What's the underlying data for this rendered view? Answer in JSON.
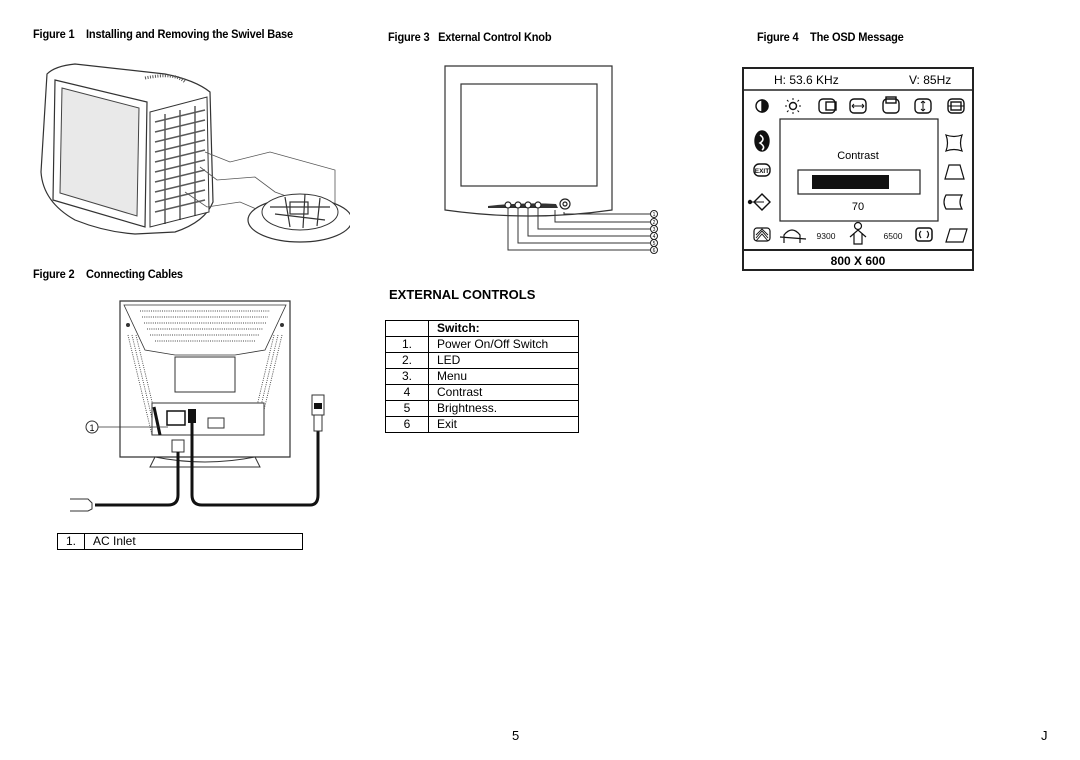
{
  "figures": {
    "fig1": {
      "label": "Figure 1",
      "title": "Installing and Removing the Swivel Base"
    },
    "fig2": {
      "label": "Figure 2",
      "title": "Connecting Cables",
      "callout": "1"
    },
    "fig3": {
      "label": "Figure 3",
      "title": "External Control Knob",
      "callouts": [
        "1",
        "2",
        "3",
        "4",
        "5",
        "6"
      ]
    },
    "fig4": {
      "label": "Figure 4",
      "title": "The OSD Message"
    }
  },
  "ac_table": {
    "rows": [
      {
        "num": "1.",
        "label": "AC Inlet"
      }
    ]
  },
  "external_controls": {
    "heading": "EXTERNAL CONTROLS",
    "header": "Switch:",
    "rows": [
      {
        "num": "1.",
        "label": "Power On/Off Switch"
      },
      {
        "num": "2.",
        "label": "LED"
      },
      {
        "num": "3.",
        "label": "Menu"
      },
      {
        "num": "4",
        "label": "Contrast"
      },
      {
        "num": "5",
        "label": "Brightness."
      },
      {
        "num": "6",
        "label": "Exit"
      }
    ]
  },
  "osd": {
    "h_freq": "H: 53.6 KHz",
    "v_freq": "V: 85Hz",
    "panel_title": "Contrast",
    "value": "70",
    "value_fraction": 0.7,
    "color_temp_1": "9300",
    "color_temp_2": "6500",
    "resolution": "800 X 600",
    "top_icons": [
      "contrast-icon",
      "brightness-icon",
      "h-position-icon",
      "h-size-icon",
      "v-position-icon",
      "v-size-icon",
      "zoom-icon"
    ],
    "left_icons": [
      "language-icon",
      "exit-icon",
      "recall-icon"
    ],
    "right_icons": [
      "pincushion-icon",
      "trapezoid-icon",
      "pin-balance-icon"
    ],
    "bottom_icons": [
      "moire-icon",
      "degauss-icon",
      "user-color-icon",
      "rotation-icon",
      "parallelogram-icon"
    ]
  },
  "footer": {
    "page_number": "5",
    "corner_letter": "J"
  }
}
